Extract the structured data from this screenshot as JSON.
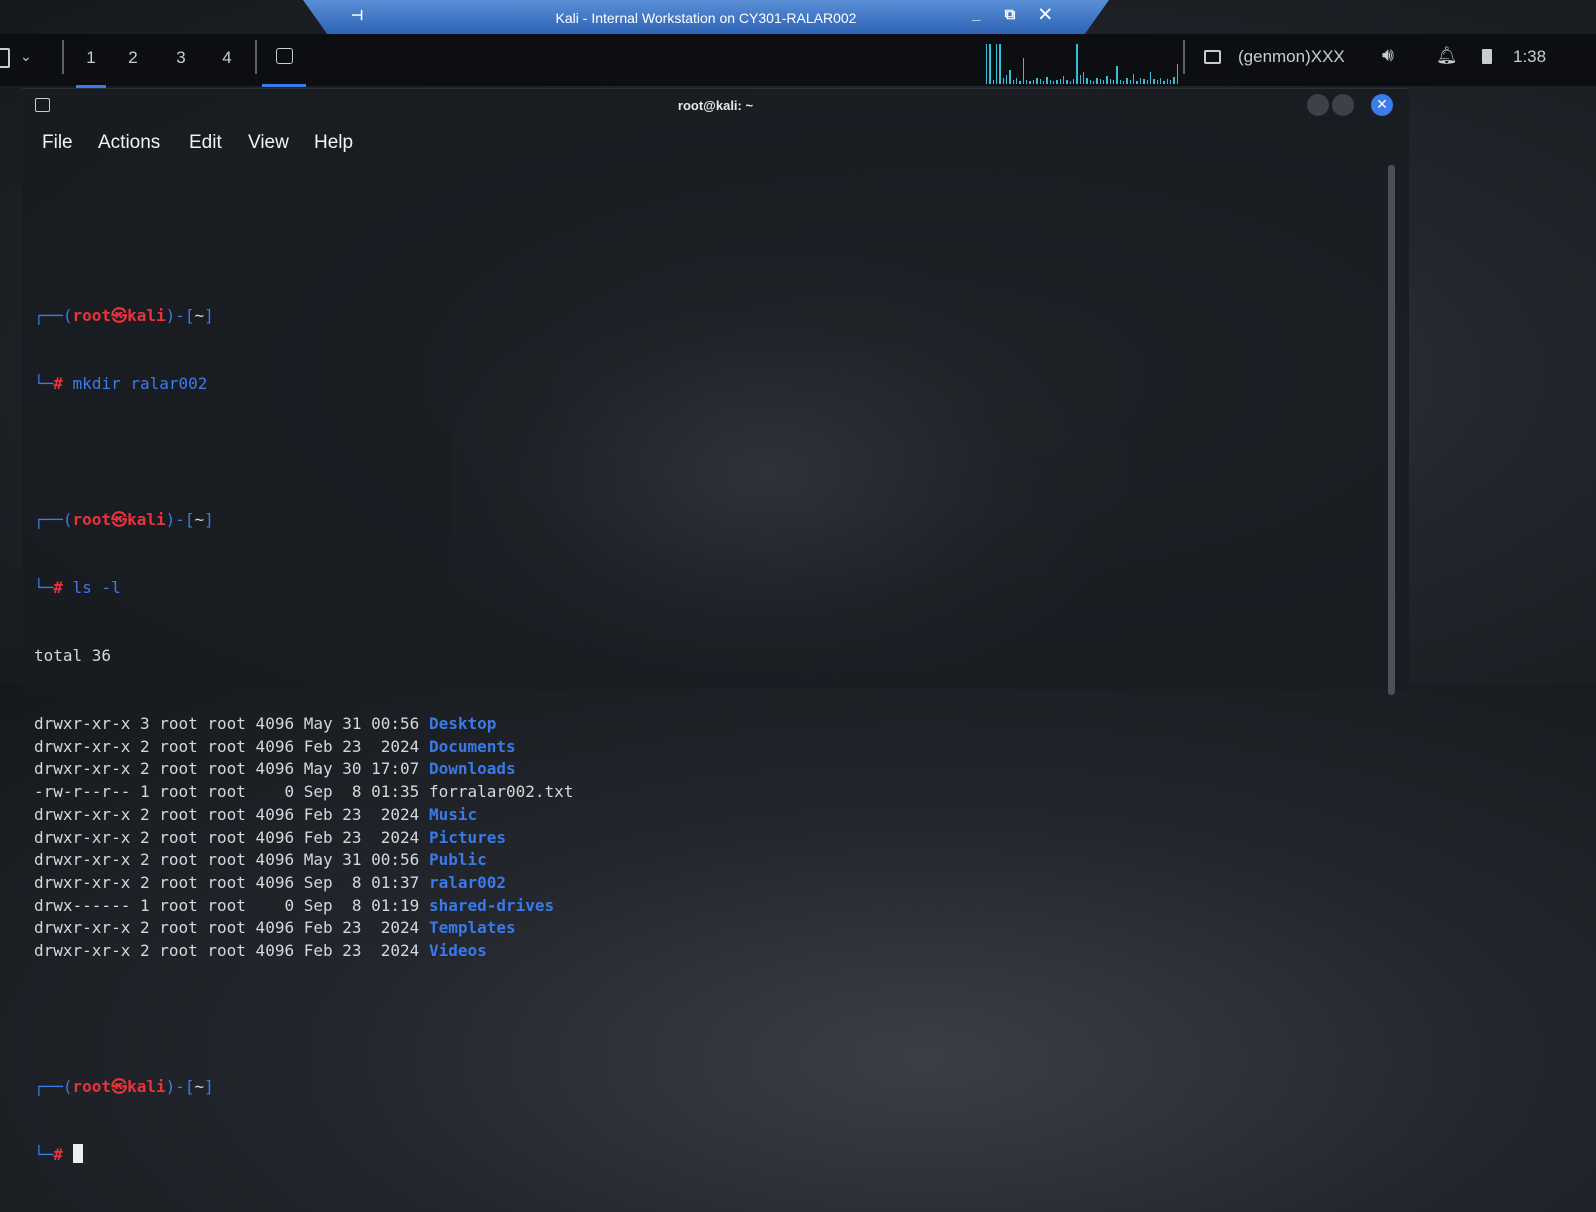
{
  "remote_bar": {
    "pin": "⊣",
    "title": "Kali - Internal Workstation on CY301-RALAR002",
    "controls": "_ ⧉ ✕"
  },
  "panel": {
    "workspaces": [
      "1",
      "2",
      "3",
      "4"
    ],
    "genmon": "(genmon)XXX",
    "volume_icon": "speaker-icon",
    "clock": "1:38"
  },
  "terminal": {
    "title": "root@kali: ~",
    "menu": [
      "File",
      "Actions",
      "Edit",
      "View",
      "Help"
    ],
    "prompt": {
      "user": "root",
      "at": "㉿",
      "host": "kali",
      "dir": "~",
      "hash": "#"
    },
    "commands": [
      "mkdir ralar002",
      "ls -l"
    ],
    "total": "total 36",
    "listing": [
      {
        "meta": "drwxr-xr-x 3 root root 4096 May 31 00:56 ",
        "name": "Desktop",
        "is_dir": true
      },
      {
        "meta": "drwxr-xr-x 2 root root 4096 Feb 23  2024 ",
        "name": "Documents",
        "is_dir": true
      },
      {
        "meta": "drwxr-xr-x 2 root root 4096 May 30 17:07 ",
        "name": "Downloads",
        "is_dir": true
      },
      {
        "meta": "-rw-r--r-- 1 root root    0 Sep  8 01:35 ",
        "name": "forralar002.txt",
        "is_dir": false
      },
      {
        "meta": "drwxr-xr-x 2 root root 4096 Feb 23  2024 ",
        "name": "Music",
        "is_dir": true
      },
      {
        "meta": "drwxr-xr-x 2 root root 4096 Feb 23  2024 ",
        "name": "Pictures",
        "is_dir": true
      },
      {
        "meta": "drwxr-xr-x 2 root root 4096 May 31 00:56 ",
        "name": "Public",
        "is_dir": true
      },
      {
        "meta": "drwxr-xr-x 2 root root 4096 Sep  8 01:37 ",
        "name": "ralar002",
        "is_dir": true
      },
      {
        "meta": "drwx------ 1 root root    0 Sep  8 01:19 ",
        "name": "shared-drives",
        "is_dir": true
      },
      {
        "meta": "drwxr-xr-x 2 root root 4096 Feb 23  2024 ",
        "name": "Templates",
        "is_dir": true
      },
      {
        "meta": "drwxr-xr-x 2 root root 4096 Feb 23  2024 ",
        "name": "Videos",
        "is_dir": true
      }
    ]
  },
  "colors": {
    "accent": "#367bf0",
    "prompt_red": "#e8323d",
    "dir_blue": "#3a79e8",
    "cpu_graph": "#35bfd6"
  }
}
